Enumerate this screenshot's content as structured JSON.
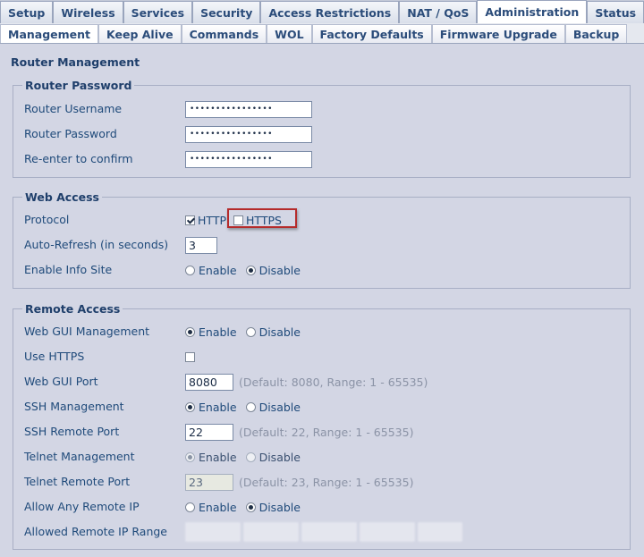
{
  "tabs_main": [
    "Setup",
    "Wireless",
    "Services",
    "Security",
    "Access Restrictions",
    "NAT / QoS",
    "Administration",
    "Status"
  ],
  "tabs_main_active": "Administration",
  "tabs_sub": [
    "Management",
    "Keep Alive",
    "Commands",
    "WOL",
    "Factory Defaults",
    "Firmware Upgrade",
    "Backup"
  ],
  "tabs_sub_active": "Management",
  "page_title": "Router Management",
  "router_password": {
    "legend": "Router Password",
    "username_label": "Router Username",
    "username_value": "••••••••••••••••",
    "password_label": "Router Password",
    "password_value": "••••••••••••••••",
    "confirm_label": "Re-enter to confirm",
    "confirm_value": "••••••••••••••••"
  },
  "web_access": {
    "legend": "Web Access",
    "protocol_label": "Protocol",
    "http_label": "HTTP",
    "https_label": "HTTPS",
    "autorefresh_label": "Auto-Refresh (in seconds)",
    "autorefresh_value": "3",
    "infosite_label": "Enable Info Site",
    "enable_label": "Enable",
    "disable_label": "Disable"
  },
  "remote_access": {
    "legend": "Remote Access",
    "webgui_label": "Web GUI Management",
    "use_https_label": "Use HTTPS",
    "webgui_port_label": "Web GUI Port",
    "webgui_port_value": "8080",
    "webgui_port_hint": "(Default: 8080, Range: 1 - 65535)",
    "ssh_label": "SSH Management",
    "ssh_port_label": "SSH Remote Port",
    "ssh_port_value": "22",
    "ssh_port_hint": "(Default: 22, Range: 1 - 65535)",
    "telnet_label": "Telnet Management",
    "telnet_port_label": "Telnet Remote Port",
    "telnet_port_value": "23",
    "telnet_port_hint": "(Default: 23, Range: 1 - 65535)",
    "any_ip_label": "Allow Any Remote IP",
    "ip_range_label": "Allowed Remote IP Range",
    "enable_label": "Enable",
    "disable_label": "Disable"
  },
  "colors": {
    "background": "#d3d6e4",
    "text": "#1f3f6b",
    "highlight": "#b52b2b"
  }
}
